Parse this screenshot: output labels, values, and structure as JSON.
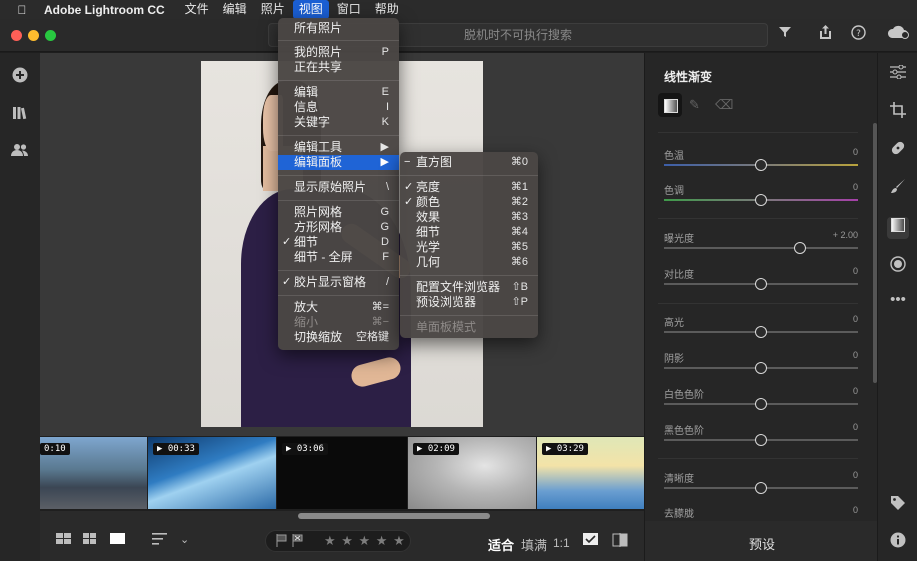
{
  "menubar": {
    "app_name": "Adobe Lightroom CC",
    "items": [
      "文件",
      "编辑",
      "照片",
      "视图",
      "窗口",
      "帮助"
    ],
    "active_item": "视图"
  },
  "titlebar": {
    "search_placeholder": "脱机时不可执行搜索"
  },
  "view_menu": {
    "items": [
      {
        "label": "所有照片",
        "key": ""
      },
      {
        "label": "我的照片",
        "key": "P"
      },
      {
        "label": "正在共享",
        "key": ""
      },
      {
        "label": "编辑",
        "key": "E"
      },
      {
        "label": "信息",
        "key": "I"
      },
      {
        "label": "关键字",
        "key": "K"
      },
      {
        "label": "编辑工具",
        "key": "▶"
      },
      {
        "label": "编辑面板",
        "key": "▶",
        "highlighted": true
      },
      {
        "label": "显示原始照片",
        "key": "\\"
      },
      {
        "label": "照片网格",
        "key": "G"
      },
      {
        "label": "方形网格",
        "key": "G"
      },
      {
        "label": "细节",
        "key": "D",
        "checked": true
      },
      {
        "label": "细节 - 全屏",
        "key": "F"
      },
      {
        "label": "胶片显示窗格",
        "key": "/",
        "checked": true
      },
      {
        "label": "放大",
        "key": "⌘="
      },
      {
        "label": "缩小",
        "key": "⌘−",
        "disabled": true
      },
      {
        "label": "切换缩放",
        "key": "空格键"
      }
    ]
  },
  "edit_panel_submenu": {
    "items": [
      {
        "label": "直方图",
        "key": "⌘0",
        "dash": true
      },
      {
        "label": "亮度",
        "key": "⌘1",
        "checked": true
      },
      {
        "label": "颜色",
        "key": "⌘2",
        "checked": true
      },
      {
        "label": "效果",
        "key": "⌘3"
      },
      {
        "label": "细节",
        "key": "⌘4"
      },
      {
        "label": "光学",
        "key": "⌘5"
      },
      {
        "label": "几何",
        "key": "⌘6"
      },
      {
        "label": "配置文件浏览器",
        "key": "⇧B"
      },
      {
        "label": "预设浏览器",
        "key": "⇧P"
      },
      {
        "label": "单面板模式",
        "key": "",
        "disabled": true
      }
    ]
  },
  "filmstrip": {
    "durations": [
      "0:10",
      "00:33",
      "03:06",
      "02:09",
      "03:29"
    ]
  },
  "bottombar": {
    "fit": "适合",
    "fill": "填满",
    "ratio": "1:1",
    "stars": "★ ★ ★ ★ ★"
  },
  "right_panel": {
    "title": "线性渐变",
    "sliders": [
      {
        "label": "色温",
        "value": "0",
        "level": 0.5
      },
      {
        "label": "色调",
        "value": "0",
        "level": 0.5
      },
      {
        "label": "曝光度",
        "value": "+ 2.00",
        "level": 0.7
      },
      {
        "label": "对比度",
        "value": "0",
        "level": 0.5
      },
      {
        "label": "高光",
        "value": "0",
        "level": 0.5
      },
      {
        "label": "阴影",
        "value": "0",
        "level": 0.5
      },
      {
        "label": "白色色阶",
        "value": "0",
        "level": 0.5
      },
      {
        "label": "黑色色阶",
        "value": "0",
        "level": 0.5
      },
      {
        "label": "清晰度",
        "value": "0",
        "level": 0.5
      },
      {
        "label": "去朦胧",
        "value": "0",
        "level": 0.5
      }
    ],
    "preset_label": "预设"
  },
  "colors": {
    "menu_highlight": "#1f64d6",
    "accent_blue": "#1b5fd3"
  }
}
